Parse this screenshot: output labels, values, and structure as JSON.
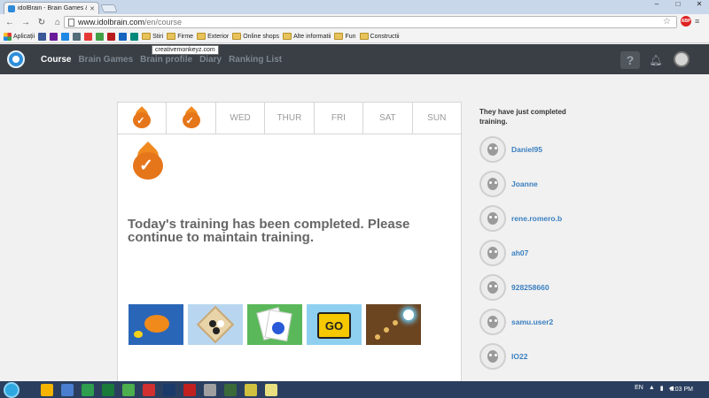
{
  "browser": {
    "tab_title": "idolBrain - Brain Games &",
    "url_host": "www.idolbrain.com",
    "url_path": "/en/course",
    "abp_label": "ABP"
  },
  "bookmarks": [
    {
      "label": "Aplicații",
      "type": "apps"
    },
    {
      "label": "",
      "type": "icon",
      "color": "#3b5998"
    },
    {
      "label": "",
      "type": "icon",
      "color": "#6a1b9a"
    },
    {
      "label": "",
      "type": "icon",
      "color": "#1e88e5"
    },
    {
      "label": "",
      "type": "icon",
      "color": "#546e7a"
    },
    {
      "label": "",
      "type": "icon",
      "color": "#e53935"
    },
    {
      "label": "",
      "type": "icon",
      "color": "#43a047"
    },
    {
      "label": "",
      "type": "icon",
      "color": "#b71c1c"
    },
    {
      "label": "",
      "type": "icon",
      "color": "#1565c0"
    },
    {
      "label": "",
      "type": "icon",
      "color": "#00897b"
    },
    {
      "label": "Stiri",
      "type": "folder"
    },
    {
      "label": "Firme",
      "type": "folder"
    },
    {
      "label": "Exterior",
      "type": "folder"
    },
    {
      "label": "Online shops",
      "type": "folder"
    },
    {
      "label": "Alte informatii",
      "type": "folder"
    },
    {
      "label": "Fun",
      "type": "folder"
    },
    {
      "label": "Constructii",
      "type": "folder"
    }
  ],
  "tooltip": "creativemonkeyz.com",
  "site_nav": {
    "items": [
      "Course",
      "Brain Games",
      "Brain profile",
      "Diary",
      "Ranking List"
    ],
    "active": "Course"
  },
  "week": {
    "days": [
      {
        "label": "",
        "completed": true
      },
      {
        "label": "",
        "completed": true
      },
      {
        "label": "WED",
        "completed": false
      },
      {
        "label": "THUR",
        "completed": false
      },
      {
        "label": "FRI",
        "completed": false
      },
      {
        "label": "SAT",
        "completed": false
      },
      {
        "label": "SUN",
        "completed": false
      }
    ]
  },
  "main": {
    "message": "Today's training has been completed. Please continue to maintain training.",
    "games": [
      {
        "name": "fish-game"
      },
      {
        "name": "go-board-game"
      },
      {
        "name": "cards-game"
      },
      {
        "name": "go-sign-game",
        "label": "GO"
      },
      {
        "name": "light-balls-game"
      }
    ]
  },
  "sidebar": {
    "title": "They have just completed training.",
    "users": [
      "Daniel95",
      "Joanne",
      "rene.romero.b",
      "ah07",
      "928258660",
      "samu.user2",
      "IO22"
    ]
  },
  "taskbar": {
    "language": "EN",
    "clock": "8:03 PM"
  },
  "colors": {
    "accent_orange": "#e6761a",
    "header_dark": "#3a3f45",
    "username_blue": "#3a7fc0"
  }
}
